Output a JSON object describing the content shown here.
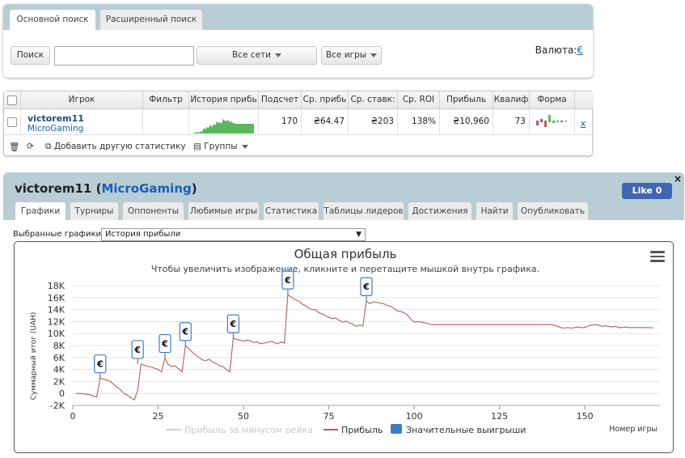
{
  "search": {
    "tabs": [
      {
        "label": "Основной поиск",
        "active": true
      },
      {
        "label": "Расширенный поиск",
        "active": false
      }
    ],
    "search_button": "Поиск",
    "search_value": "",
    "network_select": "Все сети",
    "games_select": "Все игры",
    "currency_label": "Валюта:",
    "currency_symbol": "€"
  },
  "stats_table": {
    "columns": [
      "Игрок",
      "Фильтр",
      "История прибь",
      "Подсчет",
      "Ср. прибь",
      "Ср. ставк:",
      "Ср. ROI",
      "Прибыль",
      "Квалиф",
      "Форма"
    ],
    "row": {
      "player": "victorem11",
      "network": "MicroGaming",
      "filter": "",
      "count": "170",
      "avg_profit": "₴64.47",
      "avg_stake": "₴203",
      "avg_roi": "138%",
      "profit": "₴10,960",
      "qual": "73",
      "remove": "x"
    },
    "footer": {
      "add_stats": "Добавить другую статистику",
      "groups": "Группы"
    }
  },
  "player_panel": {
    "player_name": "victorem11",
    "network": "MicroGaming",
    "like_label": "Like 0",
    "close": "×",
    "tabs": [
      "Графики",
      "Турниры",
      "Оппоненты",
      "Любимые игры",
      "Статистика",
      "Таблицы лидеров",
      "Достижения",
      "Найти",
      "Опубликовать"
    ],
    "active_tab": "Графики",
    "chart_select_label": "Выбранные графики:",
    "chart_select_value": "История прибыли",
    "chart_select_arrow": "▼"
  },
  "chart_data": {
    "type": "line",
    "title": "Общая прибыль",
    "subtitle": "Чтобы увеличить изображение, кликните и перетащите мышкой внутрь графика.",
    "ylabel": "Суммарный итог (UAH)",
    "xlabel": "Номер игры",
    "xlim": [
      0,
      172
    ],
    "ylim": [
      -2000,
      18000
    ],
    "x_ticks": [
      "0",
      "25",
      "50",
      "75",
      "100",
      "125",
      "150"
    ],
    "y_ticks": [
      "-2K",
      "0",
      "2K",
      "4K",
      "6K",
      "8K",
      "10K",
      "12K",
      "14K",
      "16K",
      "18K"
    ],
    "grid": true,
    "legend": [
      "Прибыль за минусом рейка",
      "Прибыль",
      "Значительные выигрыши"
    ],
    "series": [
      {
        "name": "Прибыль",
        "color": "#b85c5c",
        "points": [
          [
            1,
            0
          ],
          [
            3,
            -50
          ],
          [
            5,
            -200
          ],
          [
            6,
            -400
          ],
          [
            7,
            -600
          ],
          [
            8,
            2500
          ],
          [
            9,
            2400
          ],
          [
            10,
            2200
          ],
          [
            11,
            2000
          ],
          [
            12,
            1500
          ],
          [
            13,
            1000
          ],
          [
            14,
            600
          ],
          [
            15,
            0
          ],
          [
            16,
            -300
          ],
          [
            17,
            -700
          ],
          [
            18,
            -1100
          ],
          [
            19,
            500
          ],
          [
            20,
            4900
          ],
          [
            21,
            4700
          ],
          [
            22,
            4500
          ],
          [
            23,
            4400
          ],
          [
            24,
            4200
          ],
          [
            25,
            4000
          ],
          [
            26,
            3600
          ],
          [
            27,
            5900
          ],
          [
            28,
            4800
          ],
          [
            29,
            4500
          ],
          [
            30,
            4600
          ],
          [
            31,
            4100
          ],
          [
            32,
            3600
          ],
          [
            33,
            7900
          ],
          [
            34,
            7500
          ],
          [
            35,
            6900
          ],
          [
            36,
            6400
          ],
          [
            37,
            6000
          ],
          [
            38,
            5600
          ],
          [
            39,
            5500
          ],
          [
            40,
            5700
          ],
          [
            41,
            5200
          ],
          [
            42,
            5000
          ],
          [
            43,
            4600
          ],
          [
            44,
            4500
          ],
          [
            45,
            4000
          ],
          [
            46,
            3600
          ],
          [
            47,
            9200
          ],
          [
            48,
            9000
          ],
          [
            49,
            8900
          ],
          [
            50,
            8700
          ],
          [
            51,
            8900
          ],
          [
            52,
            8800
          ],
          [
            53,
            8500
          ],
          [
            54,
            8600
          ],
          [
            55,
            8300
          ],
          [
            56,
            8400
          ],
          [
            57,
            8500
          ],
          [
            58,
            8700
          ],
          [
            59,
            8500
          ],
          [
            60,
            8300
          ],
          [
            61,
            8600
          ],
          [
            62,
            8400
          ],
          [
            63,
            16500
          ],
          [
            64,
            16100
          ],
          [
            65,
            15700
          ],
          [
            66,
            15500
          ],
          [
            67,
            15000
          ],
          [
            68,
            14700
          ],
          [
            69,
            14300
          ],
          [
            70,
            14000
          ],
          [
            71,
            14000
          ],
          [
            72,
            13500
          ],
          [
            73,
            13300
          ],
          [
            74,
            13000
          ],
          [
            75,
            12700
          ],
          [
            76,
            12500
          ],
          [
            77,
            12600
          ],
          [
            78,
            12200
          ],
          [
            79,
            11900
          ],
          [
            80,
            12100
          ],
          [
            81,
            11800
          ],
          [
            82,
            11600
          ],
          [
            83,
            11200
          ],
          [
            84,
            11400
          ],
          [
            85,
            11300
          ],
          [
            86,
            15400
          ],
          [
            87,
            15000
          ],
          [
            88,
            15300
          ],
          [
            89,
            15200
          ],
          [
            90,
            15100
          ],
          [
            91,
            15000
          ],
          [
            92,
            14700
          ],
          [
            93,
            14600
          ],
          [
            94,
            14200
          ],
          [
            95,
            13800
          ],
          [
            96,
            13700
          ],
          [
            97,
            13500
          ],
          [
            98,
            13100
          ],
          [
            99,
            12400
          ],
          [
            100,
            11900
          ],
          [
            101,
            12000
          ],
          [
            102,
            11900
          ],
          [
            103,
            11800
          ],
          [
            104,
            11700
          ],
          [
            105,
            11500
          ],
          [
            110,
            11500
          ],
          [
            120,
            11500
          ],
          [
            130,
            11500
          ],
          [
            140,
            11500
          ],
          [
            141,
            11400
          ],
          [
            142,
            11200
          ],
          [
            143,
            11000
          ],
          [
            144,
            10900
          ],
          [
            145,
            11000
          ],
          [
            146,
            10900
          ],
          [
            147,
            11000
          ],
          [
            148,
            11100
          ],
          [
            149,
            11000
          ],
          [
            150,
            11000
          ],
          [
            151,
            11300
          ],
          [
            152,
            11400
          ],
          [
            153,
            11500
          ],
          [
            154,
            11400
          ],
          [
            155,
            11200
          ],
          [
            156,
            11300
          ],
          [
            157,
            11200
          ],
          [
            158,
            11100
          ],
          [
            159,
            11200
          ],
          [
            160,
            11000
          ],
          [
            161,
            11000
          ],
          [
            162,
            11100
          ],
          [
            163,
            11000
          ],
          [
            165,
            11000
          ],
          [
            167,
            11000
          ],
          [
            170,
            10960
          ]
        ]
      }
    ],
    "big_wins": [
      [
        8,
        2500
      ],
      [
        19,
        4900
      ],
      [
        27,
        5900
      ],
      [
        33,
        7900
      ],
      [
        47,
        9200
      ],
      [
        63,
        16500
      ],
      [
        86,
        15400
      ]
    ],
    "big_win_marker": "€"
  }
}
